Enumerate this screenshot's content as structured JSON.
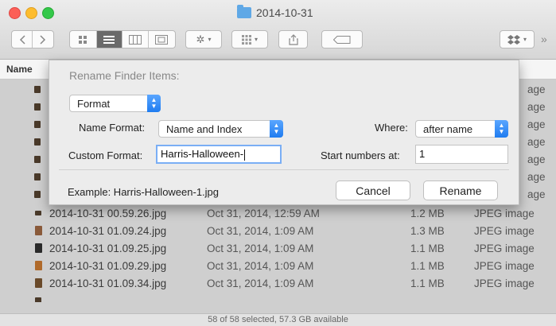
{
  "window": {
    "title": "2014-10-31",
    "status": "58 of 58 selected, 57.3 GB available"
  },
  "toolbar": {
    "back_icon": "chevron-left-icon",
    "forward_icon": "chevron-right-icon",
    "view_icons": [
      "icon-view-icon",
      "list-view-icon",
      "column-view-icon",
      "cover-flow-view-icon"
    ],
    "action_icon": "gear-icon",
    "arrange_icon": "arrange-grid-icon",
    "share_icon": "share-icon",
    "tag_icon": "tag-icon",
    "dropbox_icon": "dropbox-icon",
    "overflow": "»"
  },
  "list": {
    "column_name": "Name",
    "partial_kinds": [
      "age",
      "age",
      "age",
      "age",
      "age",
      "age",
      "age"
    ],
    "rows": [
      {
        "name": "2014-10-31 00.59.26.jpg",
        "date": "Oct 31, 2014, 12:59 AM",
        "size": "1.2 MB",
        "kind": "JPEG image"
      },
      {
        "name": "2014-10-31 01.09.24.jpg",
        "date": "Oct 31, 2014, 1:09 AM",
        "size": "1.3 MB",
        "kind": "JPEG image"
      },
      {
        "name": "2014-10-31 01.09.25.jpg",
        "date": "Oct 31, 2014, 1:09 AM",
        "size": "1.1 MB",
        "kind": "JPEG image"
      },
      {
        "name": "2014-10-31 01.09.29.jpg",
        "date": "Oct 31, 2014, 1:09 AM",
        "size": "1.1 MB",
        "kind": "JPEG image"
      },
      {
        "name": "2014-10-31 01.09.34.jpg",
        "date": "Oct 31, 2014, 1:09 AM",
        "size": "1.1 MB",
        "kind": "JPEG image"
      }
    ]
  },
  "dialog": {
    "title": "Rename Finder Items:",
    "mode": "Format",
    "name_format_label": "Name Format:",
    "name_format_value": "Name and Index",
    "where_label": "Where:",
    "where_value": "after name",
    "custom_format_label": "Custom Format:",
    "custom_format_value": "Harris-Halloween-",
    "start_numbers_label": "Start numbers at:",
    "start_numbers_value": "1",
    "example": "Example: Harris-Halloween-1.jpg",
    "cancel_label": "Cancel",
    "rename_label": "Rename"
  },
  "colors": {
    "accent": "#2f86f6",
    "selection": "#cfcfcf",
    "dialog_bg": "#ececec"
  }
}
